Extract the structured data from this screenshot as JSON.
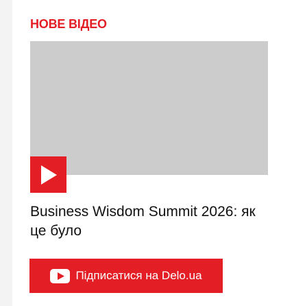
{
  "section": {
    "title": "НОВЕ ВІДЕО"
  },
  "video": {
    "title": "Business Wisdom Summit 2026: як це було",
    "play_icon": "play-icon"
  },
  "subscribe": {
    "label": "Підписатися на Delo.ua",
    "icon": "youtube-icon"
  },
  "colors": {
    "accent": "#e31e24",
    "placeholder": "#cccccc",
    "text": "#111111"
  }
}
